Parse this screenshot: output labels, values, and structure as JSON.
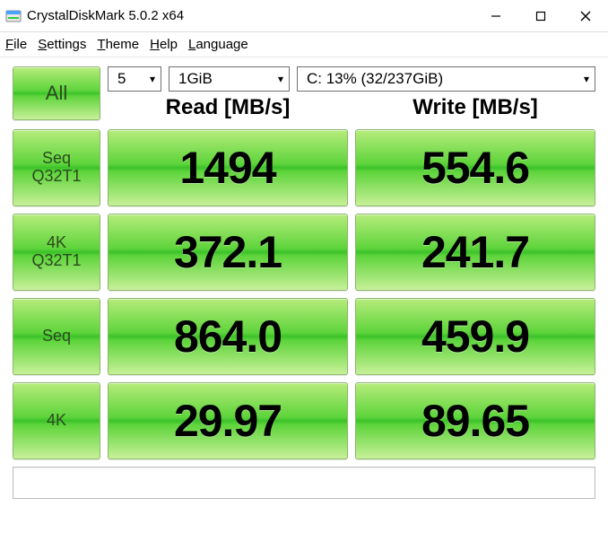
{
  "window": {
    "title": "CrystalDiskMark 5.0.2 x64"
  },
  "menu": {
    "file": "File",
    "settings": "Settings",
    "theme": "Theme",
    "help": "Help",
    "language": "Language"
  },
  "controls": {
    "all_label": "All",
    "runs": "5",
    "size": "1GiB",
    "drive": "C: 13% (32/237GiB)"
  },
  "headers": {
    "read": "Read [MB/s]",
    "write": "Write [MB/s]"
  },
  "tests": [
    {
      "label1": "Seq",
      "label2": "Q32T1",
      "read": "1494",
      "write": "554.6"
    },
    {
      "label1": "4K",
      "label2": "Q32T1",
      "read": "372.1",
      "write": "241.7"
    },
    {
      "label1": "Seq",
      "label2": "",
      "read": "864.0",
      "write": "459.9"
    },
    {
      "label1": "4K",
      "label2": "",
      "read": "29.97",
      "write": "89.65"
    }
  ],
  "status": ""
}
